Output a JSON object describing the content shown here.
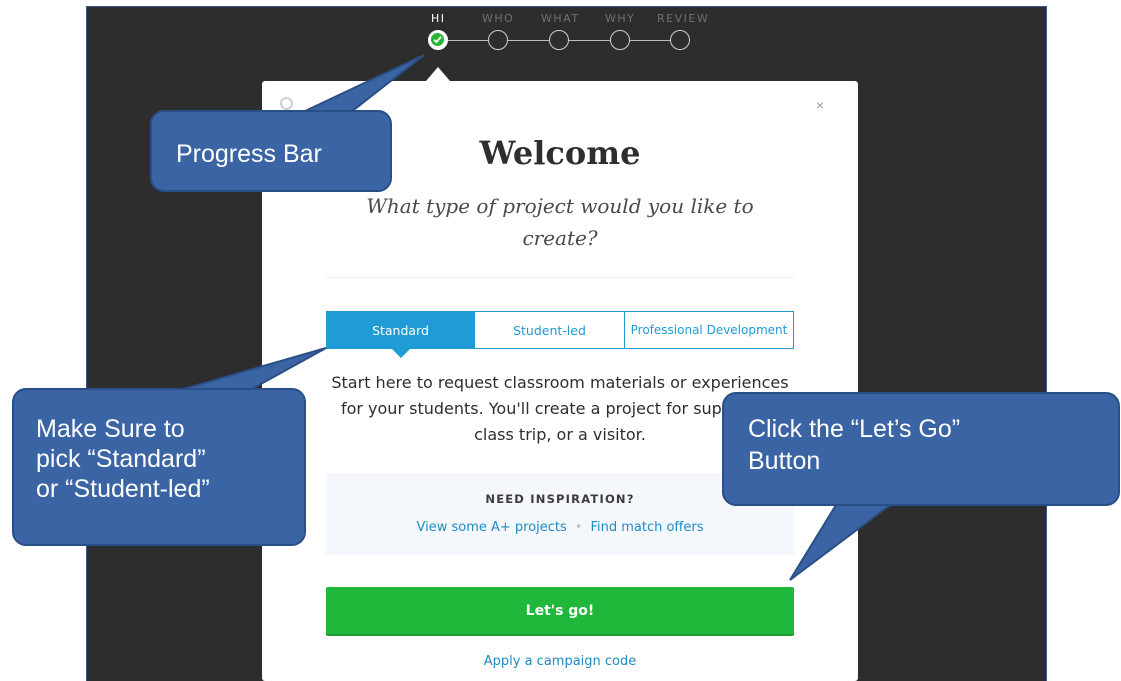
{
  "progress": {
    "steps": [
      "HI",
      "WHO",
      "WHAT",
      "WHY",
      "REVIEW"
    ],
    "current_step": 1
  },
  "modal": {
    "close_symbol": "×",
    "title": "Welcome",
    "subtitle": "What type of project would you like to create?",
    "tabs": [
      {
        "label": "Standard",
        "selected": true
      },
      {
        "label": "Student-led",
        "selected": false
      },
      {
        "label": "Professional Development",
        "selected": false
      }
    ],
    "description": "Start here to request classroom materials or experiences for your students. You'll create a project for supplies, a class trip, or a visitor.",
    "inspiration": {
      "heading": "NEED INSPIRATION?",
      "link1": "View some A+ projects",
      "link2": "Find match offers",
      "separator": "•"
    },
    "go_button": "Let's go!",
    "campaign_link": "Apply a campaign code"
  },
  "callouts": {
    "progress": "Progress Bar",
    "tab_line1": "Make Sure to",
    "tab_line2": "pick “Standard”",
    "tab_line3": "or “Student-led”",
    "button_line1": "Click the “Let’s Go”",
    "button_line2": "Button"
  },
  "colors": {
    "accent_blue": "#1f9cd6",
    "go_green": "#20b83a",
    "callout_blue": "#3a64a4",
    "dark_bg": "#2d2d2d"
  }
}
